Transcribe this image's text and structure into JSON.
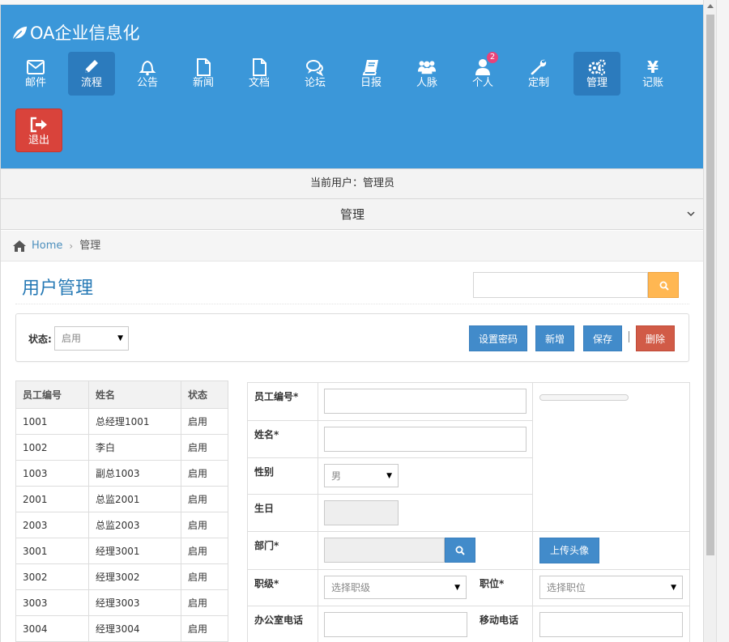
{
  "brand": {
    "title": "OA企业信息化"
  },
  "nav": [
    {
      "label": "邮件",
      "icon": "mail-icon",
      "active": false
    },
    {
      "label": "流程",
      "icon": "pencil-icon",
      "active": true
    },
    {
      "label": "公告",
      "icon": "bell-icon",
      "active": false
    },
    {
      "label": "新闻",
      "icon": "file-icon",
      "active": false
    },
    {
      "label": "文档",
      "icon": "document-icon",
      "active": false
    },
    {
      "label": "论坛",
      "icon": "chat-icon",
      "active": false
    },
    {
      "label": "日报",
      "icon": "book-icon",
      "active": false
    },
    {
      "label": "人脉",
      "icon": "users-icon",
      "active": false
    },
    {
      "label": "个人",
      "icon": "user-icon",
      "active": false,
      "badge": "2"
    },
    {
      "label": "定制",
      "icon": "wrench-icon",
      "active": false
    },
    {
      "label": "管理",
      "icon": "gears-icon",
      "active": true
    },
    {
      "label": "记账",
      "icon": "yen-icon",
      "active": false,
      "glyph": "¥"
    },
    {
      "label": "退出",
      "icon": "sign-out-icon",
      "active": false
    }
  ],
  "userbar": {
    "text": "当前用户：管理员"
  },
  "menubar": {
    "text": "管理"
  },
  "breadcrumb": {
    "home": "Home",
    "current": "管理"
  },
  "page": {
    "title": "用户管理",
    "search_placeholder": ""
  },
  "toolbar": {
    "status_label": "状态:",
    "status_value": "启用",
    "buttons": {
      "set_password": "设置密码",
      "add": "新增",
      "save": "保存",
      "delete": "删除"
    }
  },
  "user_table": {
    "headers": [
      "员工编号",
      "姓名",
      "状态"
    ],
    "rows": [
      [
        "1001",
        "总经理1001",
        "启用"
      ],
      [
        "1002",
        "李白",
        "启用"
      ],
      [
        "1003",
        "副总1003",
        "启用"
      ],
      [
        "2001",
        "总监2001",
        "启用"
      ],
      [
        "2003",
        "总监2003",
        "启用"
      ],
      [
        "3001",
        "经理3001",
        "启用"
      ],
      [
        "3002",
        "经理3002",
        "启用"
      ],
      [
        "3003",
        "经理3003",
        "启用"
      ],
      [
        "3004",
        "经理3004",
        "启用"
      ]
    ]
  },
  "form": {
    "emp_no_label": "员工编号*",
    "name_label": "姓名*",
    "gender_label": "性别",
    "gender_value": "男",
    "birthday_label": "生日",
    "dept_label": "部门*",
    "upload_avatar": "上传头像",
    "grade_label": "职级*",
    "grade_placeholder": "选择职级",
    "position_label": "职位*",
    "position_placeholder": "选择职位",
    "office_phone_label": "办公室电话",
    "mobile_label": "移动电话"
  },
  "colors": {
    "header": "#3b97d9",
    "active_nav": "#2c7bbd",
    "logout": "#d9433b",
    "primary": "#428bca",
    "danger": "#d15b47",
    "search_btn": "#ffb752",
    "title": "#2679b5"
  }
}
